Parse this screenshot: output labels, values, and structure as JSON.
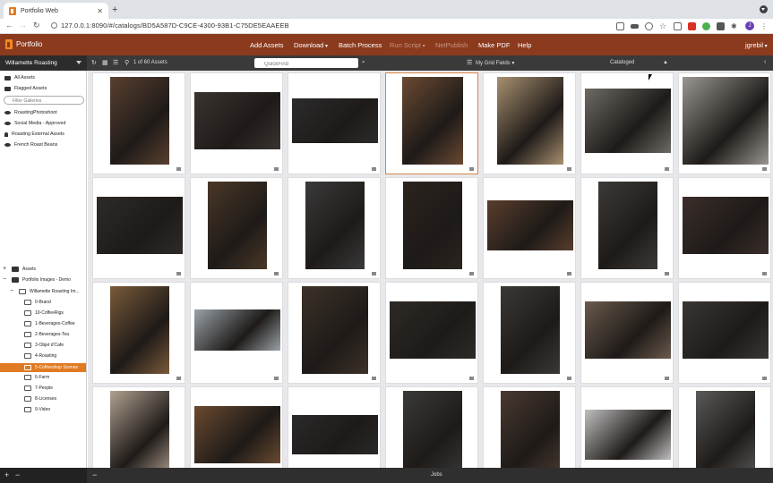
{
  "browser": {
    "tab_title": "Portfolio Web",
    "url": "127.0.0.1:8090/#/catalogs/BD5A587D-C9CE-4300-93B1-C75DE5EAAEEB",
    "avatar_letter": "J"
  },
  "header": {
    "logo": "Portfolio",
    "menu": {
      "add_assets": "Add Assets",
      "download": "Download",
      "batch_process": "Batch Process",
      "run_script": "Run Script",
      "netpublish": "NetPublish",
      "make_pdf": "Make PDF",
      "help": "Help",
      "user": "jgrebil"
    }
  },
  "toolbar": {
    "catalog": "Willamette Roasting",
    "asset_count": "1 of 60 Assets",
    "quickfind_placeholder": "QuickFind",
    "grid_fields": "My Grid Fields",
    "cataloged": "Cataloged"
  },
  "sidebar": {
    "all_assets": "All Assets",
    "flagged_assets": "Flagged Assets",
    "filter_placeholder": "Filter Galleries",
    "galleries": [
      "RoastingPhotoshoot",
      "Social Media - Approved",
      "Roasting External Assets",
      "French Roast Beans"
    ],
    "tree": {
      "assets": "Assets",
      "portfolio_images": "Portfolio Images - Demo",
      "willamette": "Willamette Roasting Im...",
      "folders": [
        "0-Brand",
        "10-CoffeeRigs",
        "1-Beverages-Coffee",
        "2-Beverages-Tea",
        "3-Objet d'Cafe",
        "4-Roasting",
        "5-Coffeeshop Scenes",
        "6-Farm",
        "7-People",
        "8-Licenses",
        "9-Video"
      ],
      "selected_folder": "5-Coffeeshop Scenes"
    }
  },
  "footer": {
    "jobs": "Jobs"
  },
  "colors": {
    "header_brown": "#8b3a1e",
    "accent_orange": "#e07b22",
    "toolbar_dark": "#3a3a3a"
  }
}
